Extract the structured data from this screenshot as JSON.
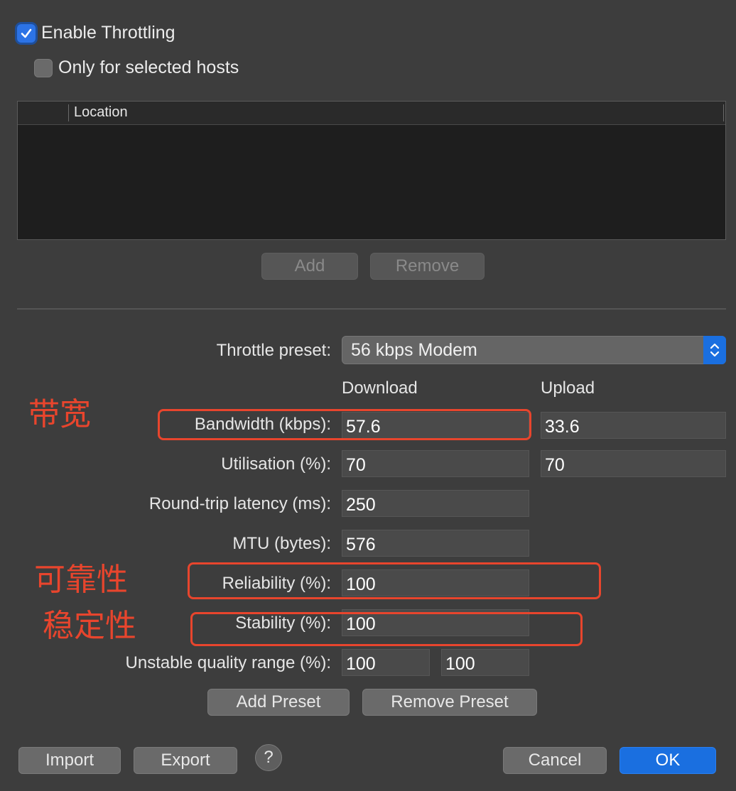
{
  "options": {
    "enable_throttling": {
      "label": "Enable Throttling",
      "checked": true
    },
    "only_selected_hosts": {
      "label": "Only for selected hosts",
      "checked": false
    }
  },
  "hosts_table": {
    "columns": [
      "Location"
    ],
    "rows": []
  },
  "hosts_buttons": {
    "add": "Add",
    "remove": "Remove"
  },
  "preset": {
    "label": "Throttle preset:",
    "value": "56 kbps Modem"
  },
  "columns": {
    "download": "Download",
    "upload": "Upload"
  },
  "fields": {
    "bandwidth": {
      "label": "Bandwidth (kbps):",
      "download": "57.6",
      "upload": "33.6"
    },
    "utilisation": {
      "label": "Utilisation (%):",
      "download": "70",
      "upload": "70"
    },
    "latency": {
      "label": "Round-trip latency (ms):",
      "value": "250"
    },
    "mtu": {
      "label": "MTU (bytes):",
      "value": "576"
    },
    "reliability": {
      "label": "Reliability (%):",
      "value": "100"
    },
    "stability": {
      "label": "Stability (%):",
      "value": "100"
    },
    "unstable_range": {
      "label": "Unstable quality range (%):",
      "min": "100",
      "max": "100"
    }
  },
  "preset_buttons": {
    "add": "Add Preset",
    "remove": "Remove Preset"
  },
  "footer": {
    "import": "Import",
    "export": "Export",
    "help": "?",
    "cancel": "Cancel",
    "ok": "OK"
  },
  "annotations": {
    "bandwidth": "带宽",
    "reliability": "可靠性",
    "stability": "稳定性"
  },
  "colors": {
    "accent": "#1a6fe0",
    "annotation": "#e8452d"
  }
}
